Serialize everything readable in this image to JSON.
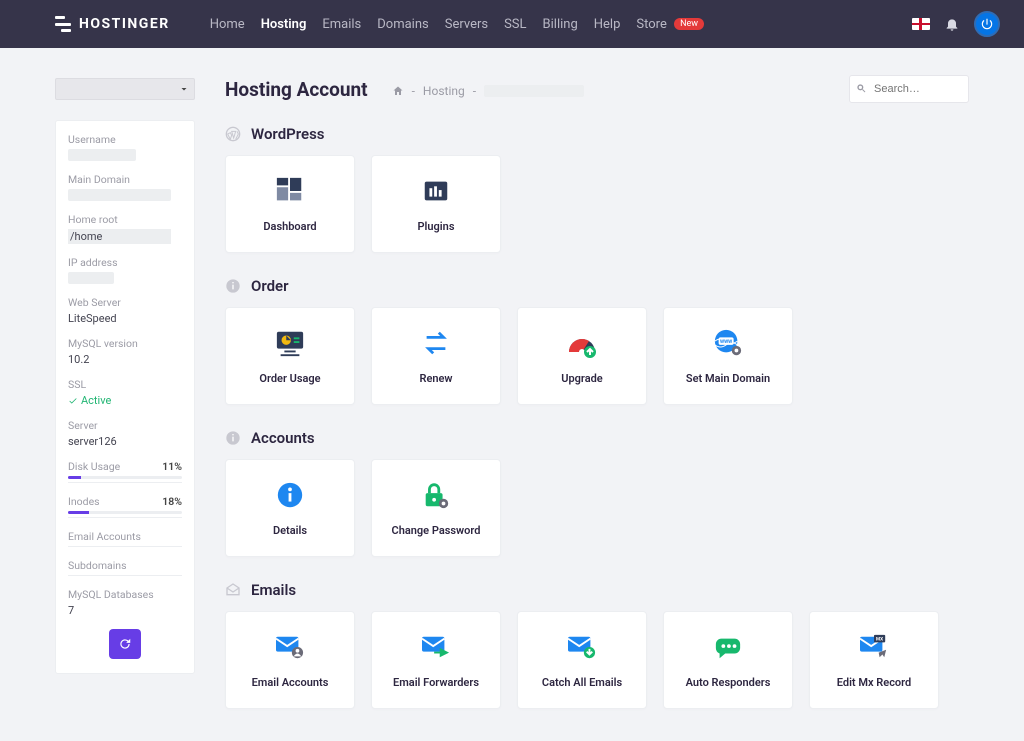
{
  "brand": "HOSTINGER",
  "nav": {
    "items": [
      {
        "label": "Home",
        "active": false
      },
      {
        "label": "Hosting",
        "active": true
      },
      {
        "label": "Emails",
        "active": false
      },
      {
        "label": "Domains",
        "active": false
      },
      {
        "label": "Servers",
        "active": false
      },
      {
        "label": "SSL",
        "active": false
      },
      {
        "label": "Billing",
        "active": false
      },
      {
        "label": "Help",
        "active": false
      },
      {
        "label": "Store",
        "active": false,
        "badge": "New"
      }
    ]
  },
  "page": {
    "title": "Hosting Account",
    "breadcrumb_label": "Hosting",
    "search_placeholder": "Search…"
  },
  "sidebar": {
    "labels": {
      "username": "Username",
      "main_domain": "Main Domain",
      "home_root": "Home root",
      "ip": "IP address",
      "web_server": "Web Server",
      "mysql": "MySQL version",
      "ssl": "SSL",
      "server": "Server",
      "disk": "Disk Usage",
      "inodes": "Inodes",
      "email_acc": "Email Accounts",
      "subdomains": "Subdomains",
      "mysql_db": "MySQL Databases"
    },
    "values": {
      "home_root": "/home",
      "web_server": "LiteSpeed",
      "mysql": "10.2",
      "ssl": "Active",
      "server": "server126",
      "disk_pct": "11%",
      "disk_fill": 11,
      "inodes_pct": "18%",
      "inodes_fill": 18,
      "mysql_db": "7"
    }
  },
  "sections": [
    {
      "key": "wordpress",
      "title": "WordPress",
      "cards": [
        {
          "key": "wp-dashboard",
          "label": "Dashboard"
        },
        {
          "key": "wp-plugins",
          "label": "Plugins"
        }
      ]
    },
    {
      "key": "order",
      "title": "Order",
      "cards": [
        {
          "key": "order-usage",
          "label": "Order Usage"
        },
        {
          "key": "renew",
          "label": "Renew"
        },
        {
          "key": "upgrade",
          "label": "Upgrade"
        },
        {
          "key": "set-main-domain",
          "label": "Set Main Domain"
        }
      ]
    },
    {
      "key": "accounts",
      "title": "Accounts",
      "cards": [
        {
          "key": "details",
          "label": "Details"
        },
        {
          "key": "change-password",
          "label": "Change Password"
        }
      ]
    },
    {
      "key": "emails",
      "title": "Emails",
      "cards": [
        {
          "key": "email-accounts",
          "label": "Email Accounts"
        },
        {
          "key": "email-forwarders",
          "label": "Email Forwarders"
        },
        {
          "key": "catch-all",
          "label": "Catch All Emails"
        },
        {
          "key": "auto-responders",
          "label": "Auto Responders"
        },
        {
          "key": "edit-mx",
          "label": "Edit Mx Record"
        }
      ]
    }
  ]
}
